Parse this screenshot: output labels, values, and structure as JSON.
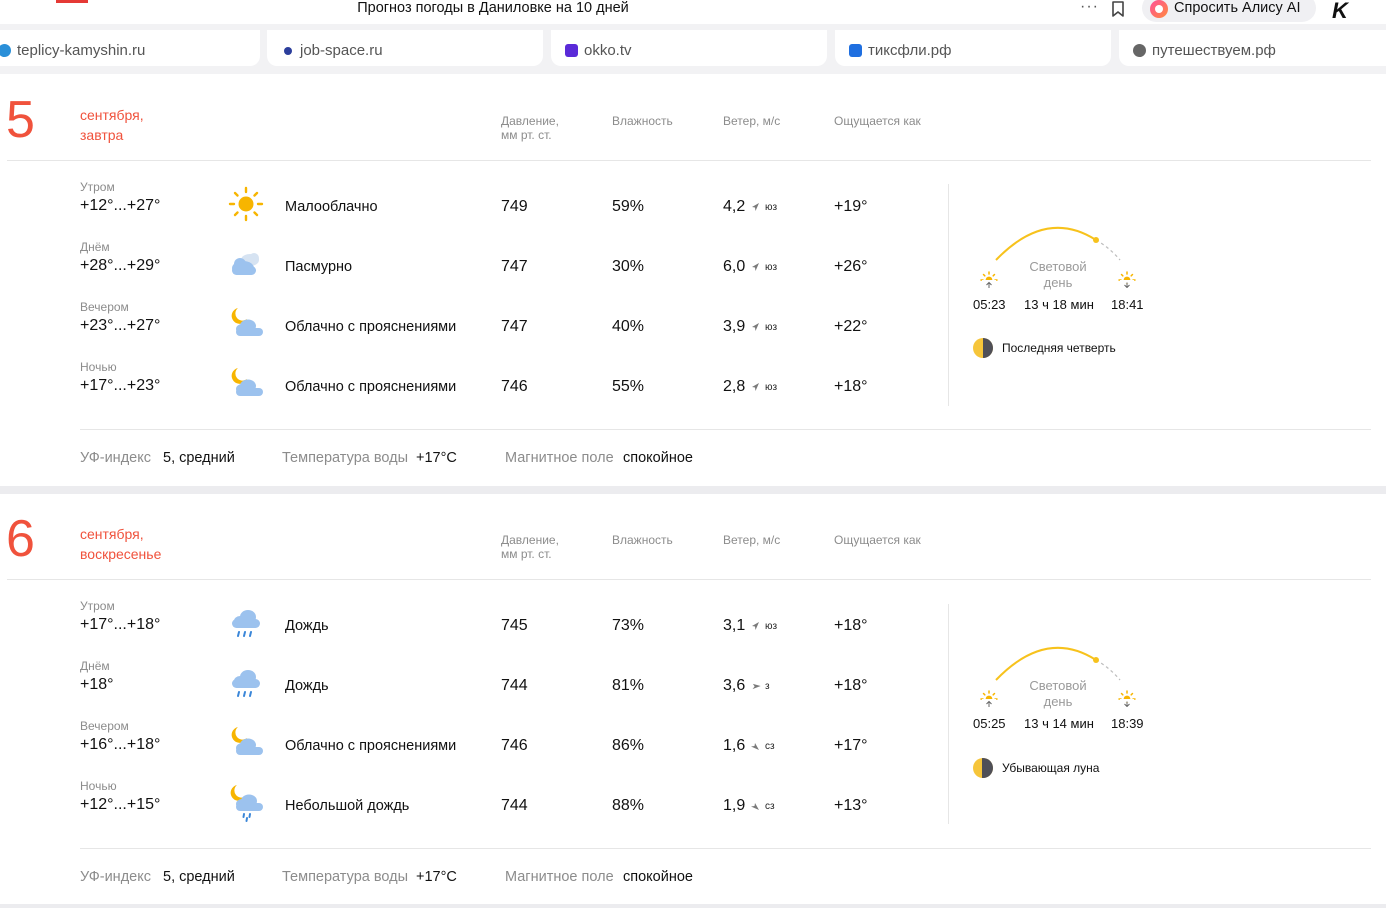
{
  "browser": {
    "title": "Прогноз погоды в Даниловке на 10 дней",
    "alice_button": "Спросить Алису AI",
    "tabs": [
      {
        "label": "teplicy-kamyshin.ru",
        "icon": "teplicy-favicon",
        "color": "#2a8fd8"
      },
      {
        "label": "job-space.ru",
        "icon": "job-space-favicon",
        "color": "#2c3e9c"
      },
      {
        "label": "okko.tv",
        "icon": "okko-favicon",
        "color": "#5a2ad8"
      },
      {
        "label": "тиксфли.рф",
        "icon": "tiksfli-favicon",
        "color": "#1f6fe0"
      },
      {
        "label": "путешествуем.рф",
        "icon": "travel-favicon",
        "color": "#666666"
      }
    ]
  },
  "columns": {
    "pressure": "Давление, мм рт. ст.",
    "humidity": "Влажность",
    "wind": "Ветер, м/с",
    "feels": "Ощущается как"
  },
  "footer_labels": {
    "uv": "УФ-индекс",
    "water": "Температура воды",
    "magnetic": "Магнитное поле"
  },
  "sun_label": "Световой день",
  "days": [
    {
      "number": "5",
      "month": "сентября,",
      "weekday": "завтра",
      "rows": [
        {
          "period": "Утром",
          "temp": "+12°...+27°",
          "icon": "sun-icon",
          "condition": "Малооблачно",
          "pressure": "749",
          "humidity": "59%",
          "wind": "4,2",
          "wind_dir": "юз",
          "feels": "+19°"
        },
        {
          "period": "Днём",
          "temp": "+28°...+29°",
          "icon": "overcast-icon",
          "condition": "Пасмурно",
          "pressure": "747",
          "humidity": "30%",
          "wind": "6,0",
          "wind_dir": "юз",
          "feels": "+26°"
        },
        {
          "period": "Вечером",
          "temp": "+23°...+27°",
          "icon": "partly-cloudy-night-icon",
          "condition": "Облачно с прояснениями",
          "pressure": "747",
          "humidity": "40%",
          "wind": "3,9",
          "wind_dir": "юз",
          "feels": "+22°"
        },
        {
          "period": "Ночью",
          "temp": "+17°...+23°",
          "icon": "partly-cloudy-night-icon",
          "condition": "Облачно с прояснениями",
          "pressure": "746",
          "humidity": "55%",
          "wind": "2,8",
          "wind_dir": "юз",
          "feels": "+18°"
        }
      ],
      "sunrise": "05:23",
      "daylight": "13 ч 18 мин",
      "sunset": "18:41",
      "moon": "Последняя четверть",
      "uv": "5, средний",
      "water": "+17°C",
      "magnetic": "спокойное"
    },
    {
      "number": "6",
      "month": "сентября,",
      "weekday": "воскресенье",
      "rows": [
        {
          "period": "Утром",
          "temp": "+17°...+18°",
          "icon": "rain-icon",
          "condition": "Дождь",
          "pressure": "745",
          "humidity": "73%",
          "wind": "3,1",
          "wind_dir": "юз",
          "feels": "+18°"
        },
        {
          "period": "Днём",
          "temp": "+18°",
          "icon": "rain-icon",
          "condition": "Дождь",
          "pressure": "744",
          "humidity": "81%",
          "wind": "3,6",
          "wind_dir": "з",
          "feels": "+18°"
        },
        {
          "period": "Вечером",
          "temp": "+16°...+18°",
          "icon": "partly-cloudy-night-icon",
          "condition": "Облачно с прояснениями",
          "pressure": "746",
          "humidity": "86%",
          "wind": "1,6",
          "wind_dir": "сз",
          "feels": "+17°"
        },
        {
          "period": "Ночью",
          "temp": "+12°...+15°",
          "icon": "light-rain-night-icon",
          "condition": "Небольшой дождь",
          "pressure": "744",
          "humidity": "88%",
          "wind": "1,9",
          "wind_dir": "сз",
          "feels": "+13°"
        }
      ],
      "sunrise": "05:25",
      "daylight": "13 ч 14 мин",
      "sunset": "18:39",
      "moon": "Убывающая луна",
      "uv": "5, средний",
      "water": "+17°C",
      "magnetic": "спокойное"
    }
  ]
}
